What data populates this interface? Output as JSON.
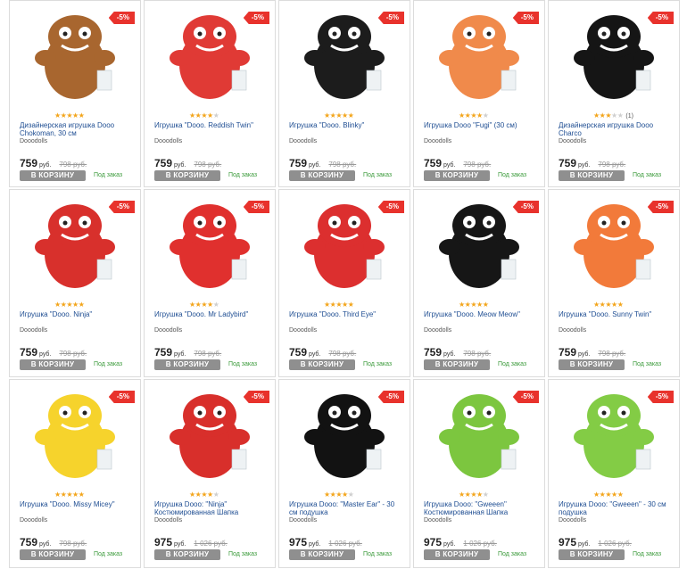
{
  "products": [
    {
      "title": "Дизайнерская игрушка Dooo Chokoman, 30 см",
      "brand": "Dooodolls",
      "price": "759",
      "currency": "руб.",
      "old_price": "798 руб.",
      "cart_label": "В КОРЗИНУ",
      "availability": "Под заказ",
      "discount": "-5%",
      "rating": 5,
      "reviews": "",
      "image": "brown-toy-icon",
      "color": "#a8662f"
    },
    {
      "title": "Игрушка \"Dooo. Reddish Twin\"",
      "brand": "Dooodolls",
      "price": "759",
      "currency": "руб.",
      "old_price": "798 руб.",
      "cart_label": "В КОРЗИНУ",
      "availability": "Под заказ",
      "discount": "-5%",
      "rating": 4,
      "reviews": "",
      "image": "red-toy-icon",
      "color": "#e03a35"
    },
    {
      "title": "Игрушка \"Dooo. Blinky\"",
      "brand": "Dooodolls",
      "price": "759",
      "currency": "руб.",
      "old_price": "798 руб.",
      "cart_label": "В КОРЗИНУ",
      "availability": "Под заказ",
      "discount": "-5%",
      "rating": 5,
      "reviews": "",
      "image": "black-toy-icon",
      "color": "#1c1c1c"
    },
    {
      "title": "Игрушка Dooo \"Fugi\" (30 см)",
      "brand": "Dooodolls",
      "price": "759",
      "currency": "руб.",
      "old_price": "798 руб.",
      "cart_label": "В КОРЗИНУ",
      "availability": "Под заказ",
      "discount": "-5%",
      "rating": 4,
      "reviews": "",
      "image": "orange-cat-toy-icon",
      "color": "#f08a4b"
    },
    {
      "title": "Дизайнерская игрушка Dooo Charco",
      "brand": "Dooodolls",
      "price": "759",
      "currency": "руб.",
      "old_price": "798 руб.",
      "cart_label": "В КОРЗИНУ",
      "availability": "Под заказ",
      "discount": "-5%",
      "rating": 3,
      "reviews": "(1)",
      "image": "black-toy-icon",
      "color": "#151515"
    },
    {
      "title": "Игрушка \"Dooo. Ninja\"",
      "brand": "Dooodolls",
      "price": "759",
      "currency": "руб.",
      "old_price": "798 руб.",
      "cart_label": "В КОРЗИНУ",
      "availability": "Под заказ",
      "discount": "-5%",
      "rating": 5,
      "reviews": "",
      "image": "ninja-toy-icon",
      "color": "#d8302c"
    },
    {
      "title": "Игрушка \"Dooo. Mr Ladybird\"",
      "brand": "Dooodolls",
      "price": "759",
      "currency": "руб.",
      "old_price": "798 руб.",
      "cart_label": "В КОРЗИНУ",
      "availability": "Под заказ",
      "discount": "-5%",
      "rating": 4,
      "reviews": "",
      "image": "ladybird-toy-icon",
      "color": "#e0302e"
    },
    {
      "title": "Игрушка \"Dooo. Third Eye\"",
      "brand": "Dooodolls",
      "price": "759",
      "currency": "руб.",
      "old_price": "798 руб.",
      "cart_label": "В КОРЗИНУ",
      "availability": "Под заказ",
      "discount": "-5%",
      "rating": 5,
      "reviews": "",
      "image": "red-toy-icon",
      "color": "#dc2f2f"
    },
    {
      "title": "Игрушка \"Dooo. Meow Meow\"",
      "brand": "Dooodolls",
      "price": "759",
      "currency": "руб.",
      "old_price": "798 руб.",
      "cart_label": "В КОРЗИНУ",
      "availability": "Под заказ",
      "discount": "-5%",
      "rating": 5,
      "reviews": "",
      "image": "black-cat-toy-icon",
      "color": "#161616"
    },
    {
      "title": "Игрушка \"Dooo. Sunny Twin\"",
      "brand": "Dooodolls",
      "price": "759",
      "currency": "руб.",
      "old_price": "798 руб.",
      "cart_label": "В КОРЗИНУ",
      "availability": "Под заказ",
      "discount": "-5%",
      "rating": 5,
      "reviews": "",
      "image": "orange-toy-icon",
      "color": "#f27a3a"
    },
    {
      "title": "Игрушка \"Dooo. Missy Micey\"",
      "brand": "Dooodolls",
      "price": "759",
      "currency": "руб.",
      "old_price": "798 руб.",
      "cart_label": "В КОРЗИНУ",
      "availability": "Под заказ",
      "discount": "-5%",
      "rating": 5,
      "reviews": "",
      "image": "yellow-toy-icon",
      "color": "#f6d32c"
    },
    {
      "title": "Игрушка Dooo: \"Ninja\" Костюмированная Шапка",
      "brand": "Dooodolls",
      "price": "975",
      "currency": "руб.",
      "old_price": "1 026 руб.",
      "cart_label": "В КОРЗИНУ",
      "availability": "Под заказ",
      "discount": "-5%",
      "rating": 4,
      "reviews": "",
      "image": "red-hat-icon",
      "color": "#d82f2b"
    },
    {
      "title": "Игрушка Dooo: \"Master Ear\" - 30 см подушка",
      "brand": "Dooodolls",
      "price": "975",
      "currency": "руб.",
      "old_price": "1 026 руб.",
      "cart_label": "В КОРЗИНУ",
      "availability": "Под заказ",
      "discount": "-5%",
      "rating": 4,
      "reviews": "",
      "image": "black-pillow-icon",
      "color": "#121212"
    },
    {
      "title": "Игрушка Dooo: \"Gweeen\" Костюмированная Шапка",
      "brand": "Dooodolls",
      "price": "975",
      "currency": "руб.",
      "old_price": "1 026 руб.",
      "cart_label": "В КОРЗИНУ",
      "availability": "Под заказ",
      "discount": "-5%",
      "rating": 4,
      "reviews": "",
      "image": "green-hat-icon",
      "color": "#7cc63f"
    },
    {
      "title": "Игрушка Dooo: \"Gweeen\" - 30 см подушка",
      "brand": "Dooodolls",
      "price": "975",
      "currency": "руб.",
      "old_price": "1 026 руб.",
      "cart_label": "В КОРЗИНУ",
      "availability": "Под заказ",
      "discount": "-5%",
      "rating": 5,
      "reviews": "",
      "image": "green-pillow-icon",
      "color": "#83cc45"
    }
  ]
}
